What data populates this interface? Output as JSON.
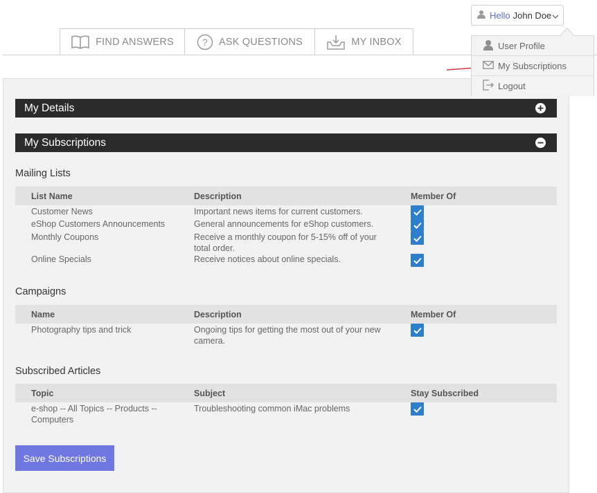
{
  "nav": {
    "tabs": [
      {
        "label": "FIND ANSWERS",
        "icon": "book-icon"
      },
      {
        "label": "ASK QUESTIONS",
        "icon": "question-circle-icon"
      },
      {
        "label": "MY INBOX",
        "icon": "inbox-icon"
      }
    ]
  },
  "user_menu": {
    "greeting": "Hello",
    "user_name": "John Doe",
    "items": [
      {
        "label": "User Profile",
        "icon": "user-icon"
      },
      {
        "label": "My Subscriptions",
        "icon": "envelope-icon"
      },
      {
        "label": "Logout",
        "icon": "logout-icon"
      }
    ]
  },
  "sections": {
    "details": {
      "title": "My Details",
      "toggle": "plus-circle-icon"
    },
    "subscriptions": {
      "title": "My Subscriptions",
      "toggle": "minus-circle-icon"
    }
  },
  "mailing_lists": {
    "title": "Mailing Lists",
    "headers": [
      "List Name",
      "Description",
      "Member Of"
    ],
    "rows": [
      {
        "name": "Customer News",
        "description": "Important news items for current customers.",
        "checked": true
      },
      {
        "name": "eShop Customers Announcements",
        "description": "General announcements for eShop customers.",
        "checked": true
      },
      {
        "name": "Monthly Coupons",
        "description": "Receive a monthly coupon for 5-15% off of your total order.",
        "checked": true
      },
      {
        "name": "Online Specials",
        "description": "Receive notices about online specials.",
        "checked": true
      }
    ]
  },
  "campaigns": {
    "title": "Campaigns",
    "headers": [
      "Name",
      "Description",
      "Member Of"
    ],
    "rows": [
      {
        "name": "Photography tips and trick",
        "description": "Ongoing tips for getting the most out of your new camera.",
        "checked": true
      }
    ]
  },
  "articles": {
    "title": "Subscribed Articles",
    "headers": [
      "Topic",
      "Subject",
      "Stay Subscribed"
    ],
    "rows": [
      {
        "name": "e-shop -- All Topics -- Products -- Computers",
        "description": "Troubleshooting common iMac problems",
        "checked": true
      }
    ]
  },
  "save_button": "Save Subscriptions",
  "colors": {
    "accent": "#6f77e0",
    "checkbox": "#2e7fcb",
    "section_bar": "#2b2b2b",
    "hello_text": "#5b6fd6"
  }
}
